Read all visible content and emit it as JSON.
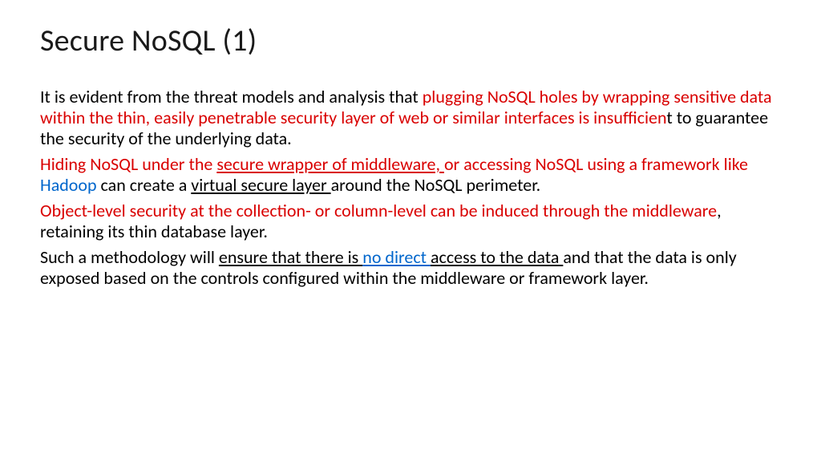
{
  "title": "Secure NoSQL (1)",
  "p1": {
    "t1": "It is evident from the threat models and analysis that ",
    "r1": "plugging NoSQL holes by wrapping sensitive data within the thin, easily penetrable security layer of web or similar interfaces is insufficien",
    "t2": "t to guarantee the security of the underlying data."
  },
  "p2": {
    "r1": "Hiding NoSQL under the ",
    "ru1": "secure wrapper of middleware, ",
    "r2": "or ",
    "r3": "accessing NoSQL using a framework like ",
    "b1": "Hadoop",
    "t1": " can create a ",
    "u1": "virtual secure layer ",
    "t2": "around the NoSQL perimeter."
  },
  "p3": {
    "r1": "Object-level security at the collection- or column-level can be induced through the middleware",
    "t1": ", retaining its thin database layer."
  },
  "p4": {
    "t1": "Such a methodology will ",
    "u1": "ensure that there is ",
    "bu1": "no direct ",
    "u2": "access to the data ",
    "t2": "and that the data is only exposed based on the controls configured within the middleware or framework layer."
  }
}
